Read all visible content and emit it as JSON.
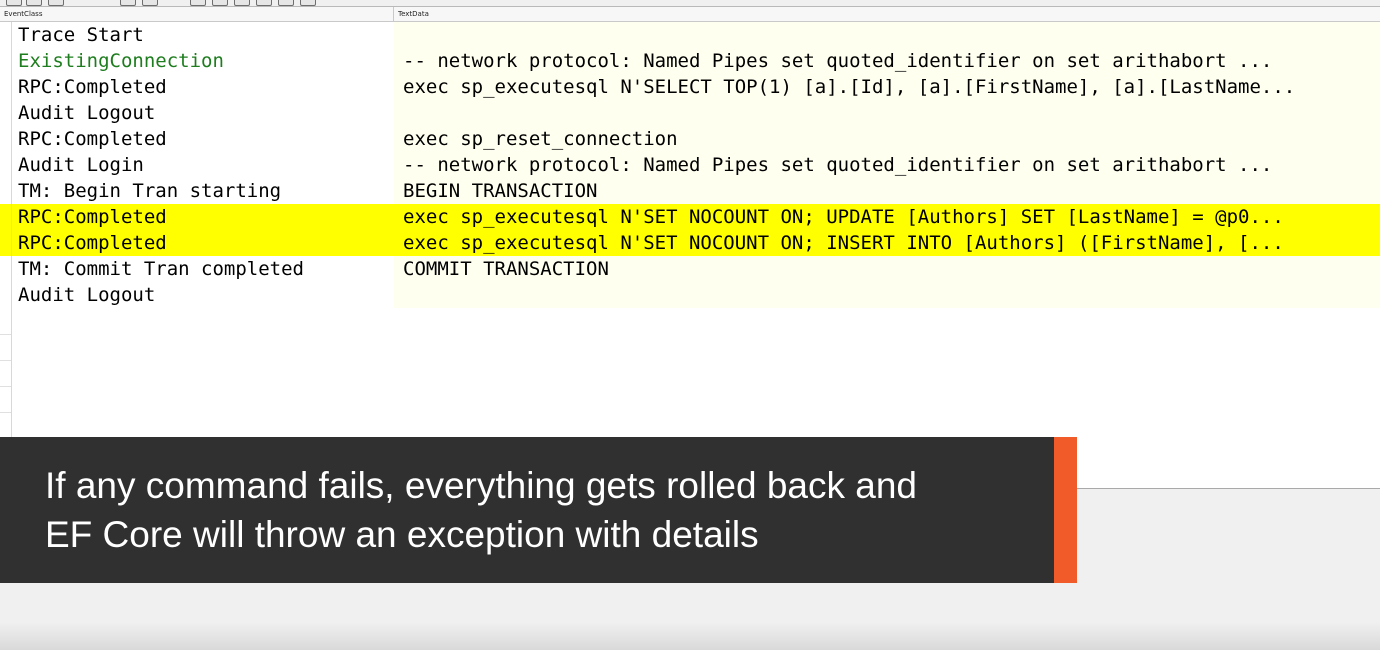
{
  "columns": {
    "event_class": "EventClass",
    "text_data": "TextData"
  },
  "colors": {
    "highlight": "#ffff00",
    "green_text": "#1e7d1e",
    "caption_bg": "#303030",
    "accent": "#f15b2a"
  },
  "rows": [
    {
      "event": "Trace Start",
      "text": ""
    },
    {
      "event": "ExistingConnection",
      "text": "-- network protocol: Named Pipes  set quoted_identifier on  set arithabort ..."
    },
    {
      "event": "RPC:Completed",
      "text": "exec sp_executesql N'SELECT TOP(1) [a].[Id], [a].[FirstName], [a].[LastName..."
    },
    {
      "event": "Audit Logout",
      "text": ""
    },
    {
      "event": "RPC:Completed",
      "text": "exec sp_reset_connection"
    },
    {
      "event": "Audit Login",
      "text": "-- network protocol: Named Pipes  set quoted_identifier on  set arithabort ..."
    },
    {
      "event": "TM: Begin Tran starting",
      "text": "BEGIN TRANSACTION"
    },
    {
      "event": "RPC:Completed",
      "text": "exec sp_executesql N'SET NOCOUNT ON;  UPDATE [Authors] SET [LastName] = @p0..."
    },
    {
      "event": "RPC:Completed",
      "text": "exec sp_executesql N'SET NOCOUNT ON;  INSERT INTO [Authors] ([FirstName], [..."
    },
    {
      "event": "TM: Commit Tran completed",
      "text": "COMMIT TRANSACTION"
    },
    {
      "event": "Audit Logout",
      "text": ""
    }
  ],
  "caption": {
    "line1": "If any command fails, everything gets rolled back and",
    "line2": "EF Core will throw an exception with details"
  }
}
